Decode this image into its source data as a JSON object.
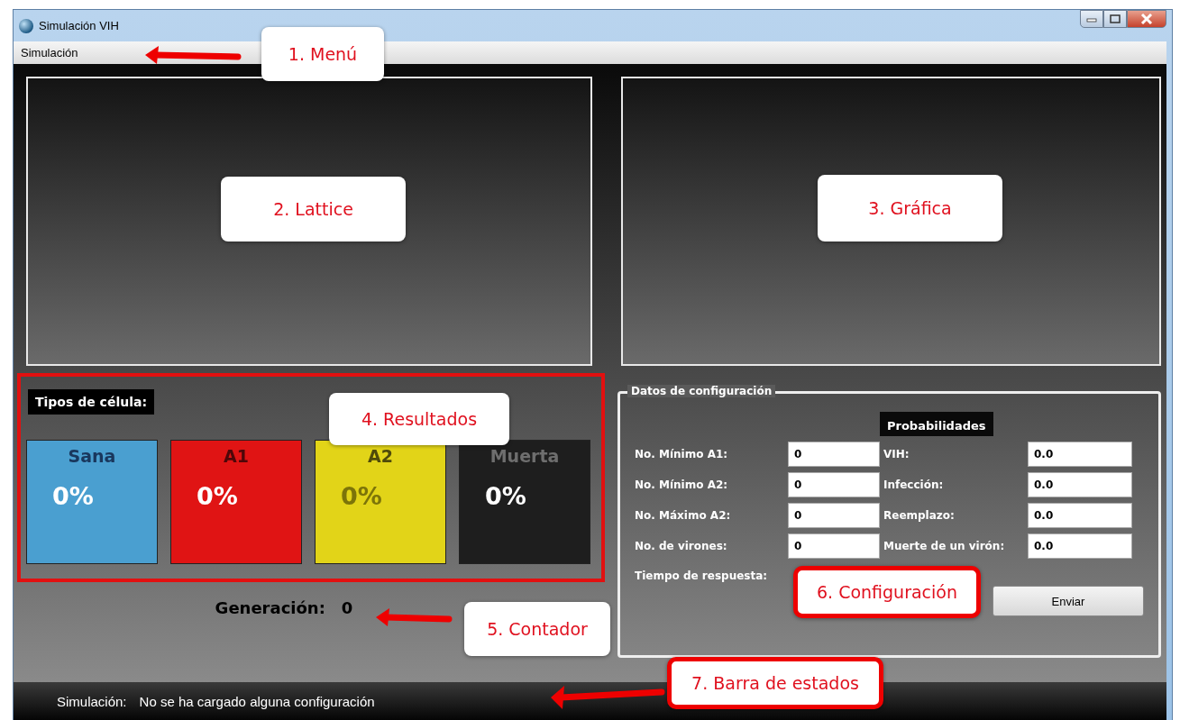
{
  "window": {
    "title": "Simulación VIH"
  },
  "menu": [
    {
      "label": "Simulación"
    }
  ],
  "results": {
    "title": "Tipos de célula:",
    "cells": [
      {
        "name": "Sana",
        "value": "0%",
        "color": "#4a9fd0"
      },
      {
        "name": "A1",
        "value": "0%",
        "color": "#e01414"
      },
      {
        "name": "A2",
        "value": "0%",
        "color": "#e2d418"
      },
      {
        "name": "Muerta",
        "value": "0%",
        "color": "#1e1e1e"
      }
    ]
  },
  "counter": {
    "label": "Generación:",
    "value": "0"
  },
  "config": {
    "title": "Datos de configuración",
    "prob_header": "Probabilidades",
    "left_fields": [
      {
        "label": "No. Mínimo A1:",
        "value": "0"
      },
      {
        "label": "No. Mínimo A2:",
        "value": "0"
      },
      {
        "label": "No. Máximo A2:",
        "value": "0"
      },
      {
        "label": "No. de virones:",
        "value": "0"
      }
    ],
    "right_fields": [
      {
        "label": "VIH:",
        "value": "0.0"
      },
      {
        "label": "Infección:",
        "value": "0.0"
      },
      {
        "label": "Reemplazo:",
        "value": "0.0"
      },
      {
        "label": "Muerte de un virón:",
        "value": "0.0"
      }
    ],
    "extra_label": "Tiempo de respuesta:",
    "button": "Enviar"
  },
  "status_bar": {
    "label": "Simulación:",
    "message": "No se ha cargado alguna configuración"
  },
  "annotations": [
    {
      "text": "1. Menú",
      "outlined": false
    },
    {
      "text": "2. Lattice",
      "outlined": false
    },
    {
      "text": "3. Gráfica",
      "outlined": false
    },
    {
      "text": "4. Resultados",
      "outlined": false
    },
    {
      "text": "5. Contador",
      "outlined": false
    },
    {
      "text": "6. Configuración",
      "outlined": true
    },
    {
      "text": "7. Barra de estados",
      "outlined": true
    }
  ]
}
